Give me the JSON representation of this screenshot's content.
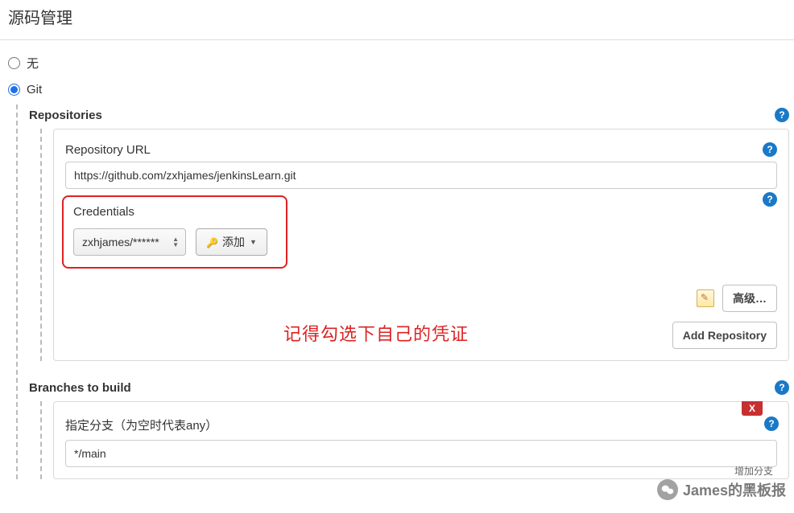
{
  "section": {
    "title": "源码管理"
  },
  "scm": {
    "options": {
      "none": {
        "label": "无",
        "checked": false
      },
      "git": {
        "label": "Git",
        "checked": true
      }
    }
  },
  "repositories": {
    "title": "Repositories",
    "url_label": "Repository URL",
    "url_value": "https://github.com/zxhjames/jenkinsLearn.git",
    "credentials": {
      "label": "Credentials",
      "selected": "zxhjames/******",
      "add_button": "添加"
    },
    "annotation": "记得勾选下自己的凭证",
    "advanced_button": "高级…",
    "add_repo_button": "Add Repository"
  },
  "branches": {
    "title": "Branches to build",
    "spec_label": "指定分支（为空时代表any）",
    "spec_value": "*/main",
    "close_label": "X",
    "add_branch_hint": "增加分支"
  },
  "watermark": {
    "text": "James的黑板报"
  }
}
